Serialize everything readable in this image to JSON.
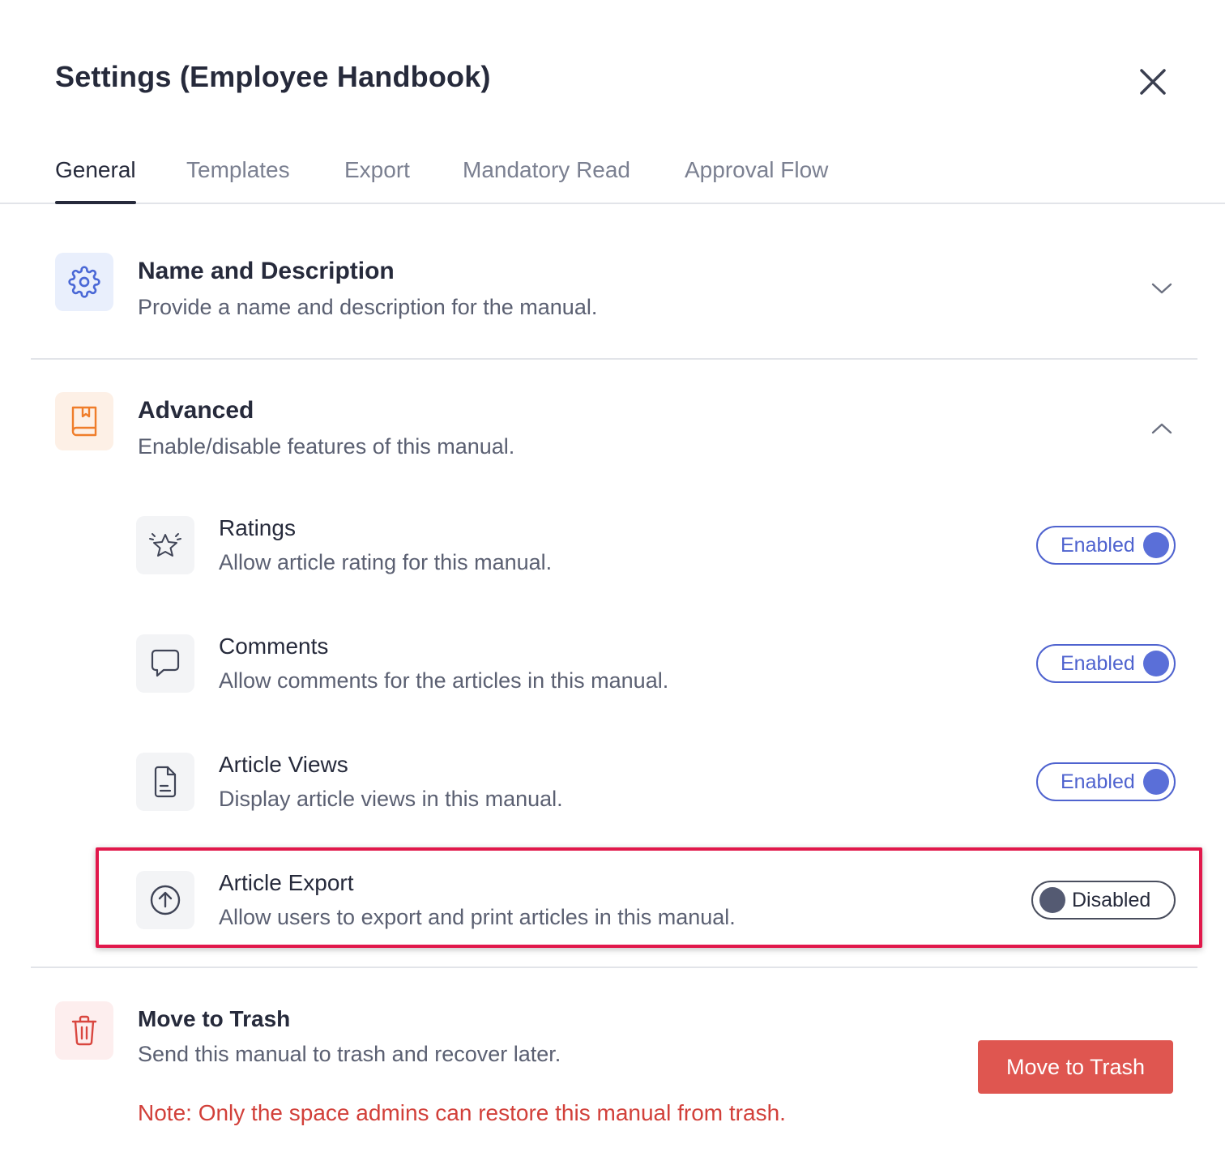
{
  "dialog": {
    "title": "Settings (Employee Handbook)"
  },
  "tabs": [
    {
      "label": "General",
      "active": true
    },
    {
      "label": "Templates",
      "active": false
    },
    {
      "label": "Export",
      "active": false
    },
    {
      "label": "Mandatory Read",
      "active": false
    },
    {
      "label": "Approval Flow",
      "active": false
    }
  ],
  "sections": {
    "name_description": {
      "title": "Name and Description",
      "description": "Provide a name and description for the manual.",
      "icon": "gear-icon",
      "expanded": false
    },
    "advanced": {
      "title": "Advanced",
      "description": "Enable/disable features of this manual.",
      "icon": "book-icon",
      "expanded": true,
      "features": [
        {
          "title": "Ratings",
          "description": "Allow article rating for this manual.",
          "icon": "star-icon",
          "state": "Enabled"
        },
        {
          "title": "Comments",
          "description": "Allow comments for the articles in this manual.",
          "icon": "comment-icon",
          "state": "Enabled"
        },
        {
          "title": "Article Views",
          "description": "Display article views in this manual.",
          "icon": "document-icon",
          "state": "Enabled"
        },
        {
          "title": "Article Export",
          "description": "Allow users to export and print articles in this manual.",
          "icon": "upload-icon",
          "state": "Disabled"
        }
      ]
    },
    "trash": {
      "title": "Move to Trash",
      "description": "Send this manual to trash and recover later.",
      "button_label": "Move to Trash",
      "note": "Note: Only the space admins can restore this manual from trash.",
      "icon": "trash-icon"
    }
  },
  "colors": {
    "accent": "#4f63cf",
    "danger": "#df5650",
    "highlight": "#e1184b",
    "heading": "#262a3b"
  }
}
